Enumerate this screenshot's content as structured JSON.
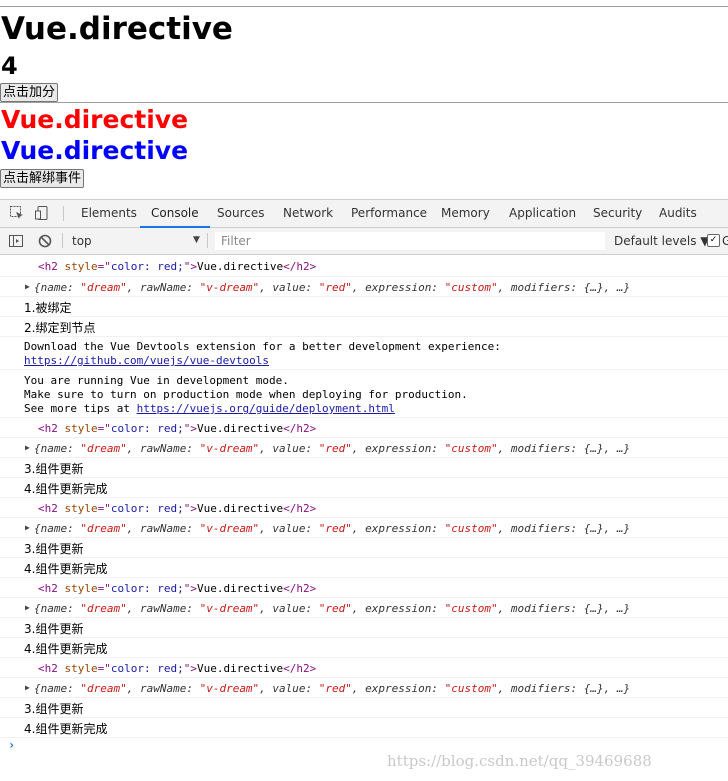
{
  "page": {
    "title": "Vue.directive",
    "score": "4",
    "add_button": "点击加分",
    "red_heading": "Vue.directive",
    "blue_heading": "Vue.directive",
    "unbind_button": "点击解绑事件",
    "colors": {
      "red": "#ff0000",
      "blue": "#0000ff"
    }
  },
  "devtools": {
    "tabs": [
      "Elements",
      "Console",
      "Sources",
      "Network",
      "Performance",
      "Memory",
      "Application",
      "Security",
      "Audits"
    ],
    "active_tab": "Console",
    "context": "top",
    "filter_placeholder": "Filter",
    "levels": "Default levels ▼"
  },
  "console": {
    "h2_line": {
      "open": "<h2 ",
      "attr": "style",
      "eq": "=\"",
      "value": "color: red;",
      "close_q": "\">",
      "text": "Vue.directive",
      "end": "</h2>"
    },
    "binding": {
      "p1": "{name: ",
      "v1": "\"dream\"",
      "p2": ", rawName: ",
      "v2": "\"v-dream\"",
      "p3": ", value: ",
      "v3": "\"red\"",
      "p4": ", expression: ",
      "v4": "\"custom\"",
      "p5": ", modifiers: {…}, …}"
    },
    "bind_msg": "1.被绑定",
    "inserted_msg": "2.绑定到节点",
    "devtools_msg": "Download the Vue Devtools extension for a better development experience:",
    "devtools_link": "https://github.com/vuejs/vue-devtools",
    "dev_mode_1": "You are running Vue in development mode.",
    "dev_mode_2": "Make sure to turn on production mode when deploying for production.",
    "dev_mode_3_prefix": "See more tips at ",
    "dev_mode_3_link": "https://vuejs.org/guide/deployment.html",
    "update_msg": "3.组件更新",
    "updated_msg": "4.组件更新完成",
    "prompt": "›"
  },
  "watermark": "https://blog.csdn.net/qq_39469688"
}
